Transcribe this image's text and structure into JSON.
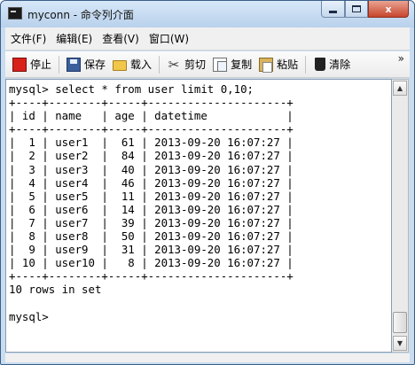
{
  "window": {
    "title": "myconn - 命令列介面",
    "controls": {
      "close_label": "x"
    }
  },
  "menu": [
    "文件(F)",
    "编辑(E)",
    "查看(V)",
    "窗口(W)"
  ],
  "toolbar": {
    "stop": "停止",
    "save": "保存",
    "load": "载入",
    "cut": "剪切",
    "copy": "复制",
    "paste": "粘贴",
    "clear": "清除",
    "more": "»"
  },
  "console": {
    "lines": [
      "mysql> select * from user limit 0,10;",
      "+----+--------+-----+---------------------+",
      "| id | name   | age | datetime            |",
      "+----+--------+-----+---------------------+",
      "|  1 | user1  |  61 | 2013-09-20 16:07:27 |",
      "|  2 | user2  |  84 | 2013-09-20 16:07:27 |",
      "|  3 | user3  |  40 | 2013-09-20 16:07:27 |",
      "|  4 | user4  |  46 | 2013-09-20 16:07:27 |",
      "|  5 | user5  |  11 | 2013-09-20 16:07:27 |",
      "|  6 | user6  |  14 | 2013-09-20 16:07:27 |",
      "|  7 | user7  |  39 | 2013-09-20 16:07:27 |",
      "|  8 | user8  |  50 | 2013-09-20 16:07:27 |",
      "|  9 | user9  |  31 | 2013-09-20 16:07:27 |",
      "| 10 | user10 |   8 | 2013-09-20 16:07:27 |",
      "+----+--------+-----+---------------------+",
      "10 rows in set",
      "",
      "mysql>"
    ]
  },
  "colors": {
    "stop_icon": "#d8211b",
    "title_gradient_top": "#d7e7f8",
    "close_button": "#c7452c"
  }
}
